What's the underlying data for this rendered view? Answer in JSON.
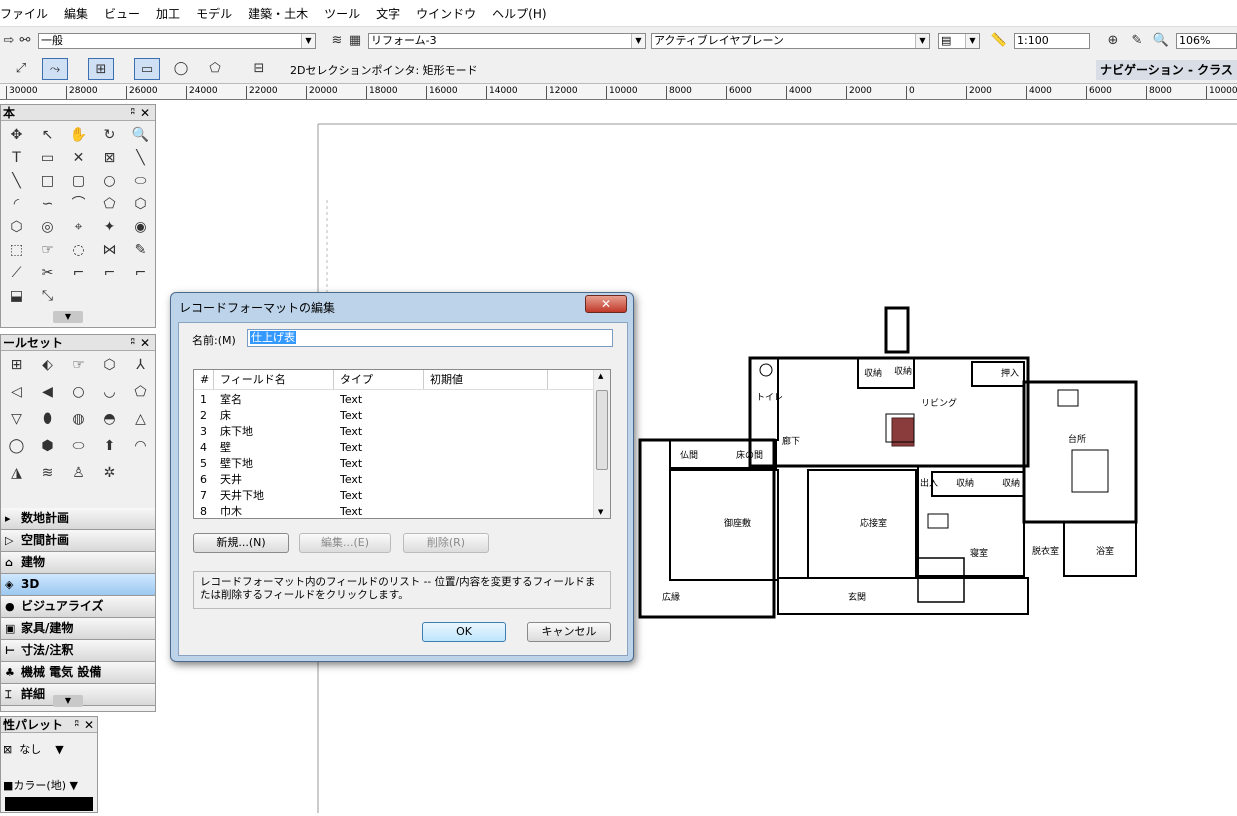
{
  "menu": [
    "ファイル",
    "編集",
    "ビュー",
    "加工",
    "モデル",
    "建築・土木",
    "ツール",
    "文字",
    "ウインドウ",
    "ヘルプ(H)"
  ],
  "toolbar1": {
    "class_select": "一般",
    "layer_select": "リフォーム-3",
    "plane_select": "アクティブレイヤプレーン",
    "scale": "1:100",
    "zoom": "106%"
  },
  "toolbar2": {
    "mode_text": "2Dセレクションポインタ: 矩形モード",
    "nav_class": "ナビゲーション - クラス"
  },
  "ruler": [
    "30000",
    "28000",
    "26000",
    "24000",
    "22000",
    "20000",
    "18000",
    "16000",
    "14000",
    "12000",
    "10000",
    "8000",
    "6000",
    "4000",
    "2000",
    "0",
    "2000",
    "4000",
    "6000",
    "8000",
    "10000"
  ],
  "palettes": {
    "basic_title": "本",
    "toolset_title": "ールセット",
    "toolsets": [
      "数地計画",
      "空間計画",
      "建物",
      "3D",
      "ビジュアライズ",
      "家具/建物",
      "寸法/注釈",
      "機械 電気 設備",
      "詳細"
    ],
    "attr_title": "性パレット",
    "attr_fill": "なし",
    "attr_color": "カラー(地)"
  },
  "plan_labels": {
    "toilet": "トイレ",
    "corridor": "廊下",
    "storage1": "収納",
    "storage2": "収納",
    "closet": "押入",
    "living": "リビング",
    "kitchen": "台所",
    "butsuma": "仏間",
    "tokonoma": "床の間",
    "deiri": "出入",
    "storage3": "収納",
    "storage4": "収納",
    "zashiki": "御座敷",
    "reception": "応接室",
    "bedroom": "寝室",
    "dressing": "脱衣室",
    "bath": "浴室",
    "engawa": "広縁",
    "entrance": "玄関"
  },
  "dialog": {
    "title": "レコードフォーマットの編集",
    "name_label": "名前:(M)",
    "name_value": "仕上げ表",
    "columns": [
      "#",
      "フィールド名",
      "タイプ",
      "初期値"
    ],
    "rows": [
      {
        "n": "1",
        "name": "室名",
        "type": "Text"
      },
      {
        "n": "2",
        "name": "床",
        "type": "Text"
      },
      {
        "n": "3",
        "name": "床下地",
        "type": "Text"
      },
      {
        "n": "4",
        "name": "壁",
        "type": "Text"
      },
      {
        "n": "5",
        "name": "壁下地",
        "type": "Text"
      },
      {
        "n": "6",
        "name": "天井",
        "type": "Text"
      },
      {
        "n": "7",
        "name": "天井下地",
        "type": "Text"
      },
      {
        "n": "8",
        "name": "巾木",
        "type": "Text"
      }
    ],
    "new_btn": "新規...(N)",
    "edit_btn": "編集...(E)",
    "delete_btn": "削除(R)",
    "info": "レコードフォーマット内のフィールドのリスト -- 位置/内容を変更するフィールドまたは削除するフィールドをクリックします。",
    "ok": "OK",
    "cancel": "キャンセル"
  }
}
